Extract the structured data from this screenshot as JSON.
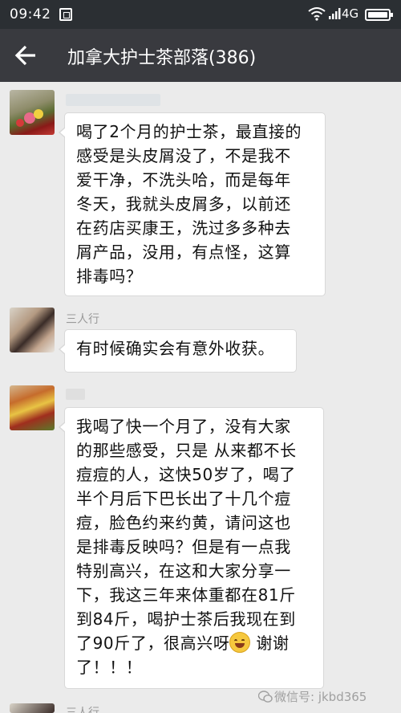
{
  "status_bar": {
    "time": "09:42",
    "network": "4G"
  },
  "header": {
    "title": "加拿大护士茶部落(386)"
  },
  "messages": [
    {
      "sender": "",
      "text": "喝了2个月的护士茶，最直接的\n感受是头皮屑没了，不是我不\n爱干净，不洗头哈，而是每年\n冬天，我就头皮屑多，以前还\n在药店买康王，洗过多多种去\n屑产品，没用，有点怪，这算\n排毒吗？"
    },
    {
      "sender": "三人行",
      "text": "有时候确实会有意外收获。"
    },
    {
      "sender": "",
      "text": "我喝了快一个月了，没有大家\n的那些感受，只是 从来都不长\n痘痘的人，这快50岁了，喝了\n半个月后下巴长出了十几个痘\n痘，脸色约来约黄，请问这也\n是排毒反映吗？但是有一点我\n特别高兴，在这和大家分享一\n下，我这三年来体重都在81斤\n到84斤，喝护士茶后我现在到\n了90斤了，很高兴呀",
      "text_after_emoji": " 谢谢\n了！！！"
    },
    {
      "sender": "三人行"
    }
  ],
  "watermark": "微信号: jkbd365",
  "colors": {
    "status_bar_bg": "#2b2f33",
    "title_bar_bg": "#393a3f",
    "chat_bg": "#ebebeb",
    "bubble_bg": "#ffffff"
  },
  "icons": [
    "scan-icon",
    "wifi-icon",
    "signal-icon",
    "battery-icon",
    "back-arrow-icon",
    "grin-emoji-icon",
    "wechat-icon"
  ]
}
